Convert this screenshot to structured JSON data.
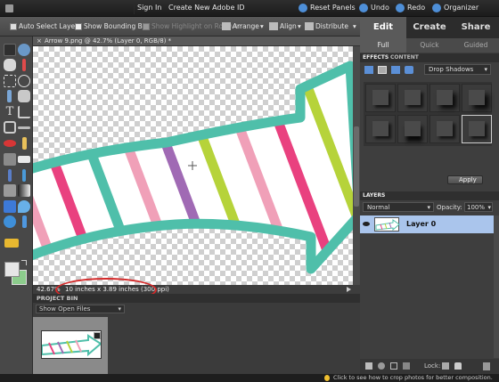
{
  "menu": {
    "sign_in": "Sign In",
    "create_id": "Create New Adobe ID",
    "reset_panels": "Reset Panels",
    "undo": "Undo",
    "redo": "Redo",
    "organizer": "Organizer"
  },
  "options_bar": {
    "auto_select": "Auto Select Layer",
    "show_bounding": "Show Bounding Box",
    "show_highlight": "Show Highlight on Rollover",
    "arrange": "Arrange",
    "align": "Align",
    "distribute": "Distribute"
  },
  "document": {
    "tab_title": "Arrow 9.png @ 42.7% (Layer 0, RGB/8) *",
    "zoom": "42.67%",
    "dimensions": "10 inches x 3.89 inches (300 ppi)"
  },
  "project_bin": {
    "header": "PROJECT BIN",
    "dropdown": "Show Open Files"
  },
  "mode_tabs": [
    "Edit",
    "Create",
    "Share"
  ],
  "sub_tabs": [
    "Full",
    "Quick",
    "Guided"
  ],
  "effects": {
    "tabs": [
      "EFFECTS",
      "CONTENT"
    ],
    "dropdown": "Drop Shadows",
    "apply": "Apply"
  },
  "layers": {
    "header": "LAYERS",
    "blend_mode": "Normal",
    "opacity_label": "Opacity:",
    "opacity_value": "100%",
    "layer_name": "Layer 0",
    "lock_label": "Lock:"
  },
  "status_tip": "Click to see how to crop photos for better composition.",
  "colors": {
    "accent_blue": "#5b8fd6",
    "teal": "#4fbfaa",
    "pink": "#e9417f",
    "light_pink": "#f0a0b8",
    "green": "#b6d33a",
    "purple": "#a06ab4",
    "highlight_red": "#d42a2a"
  }
}
